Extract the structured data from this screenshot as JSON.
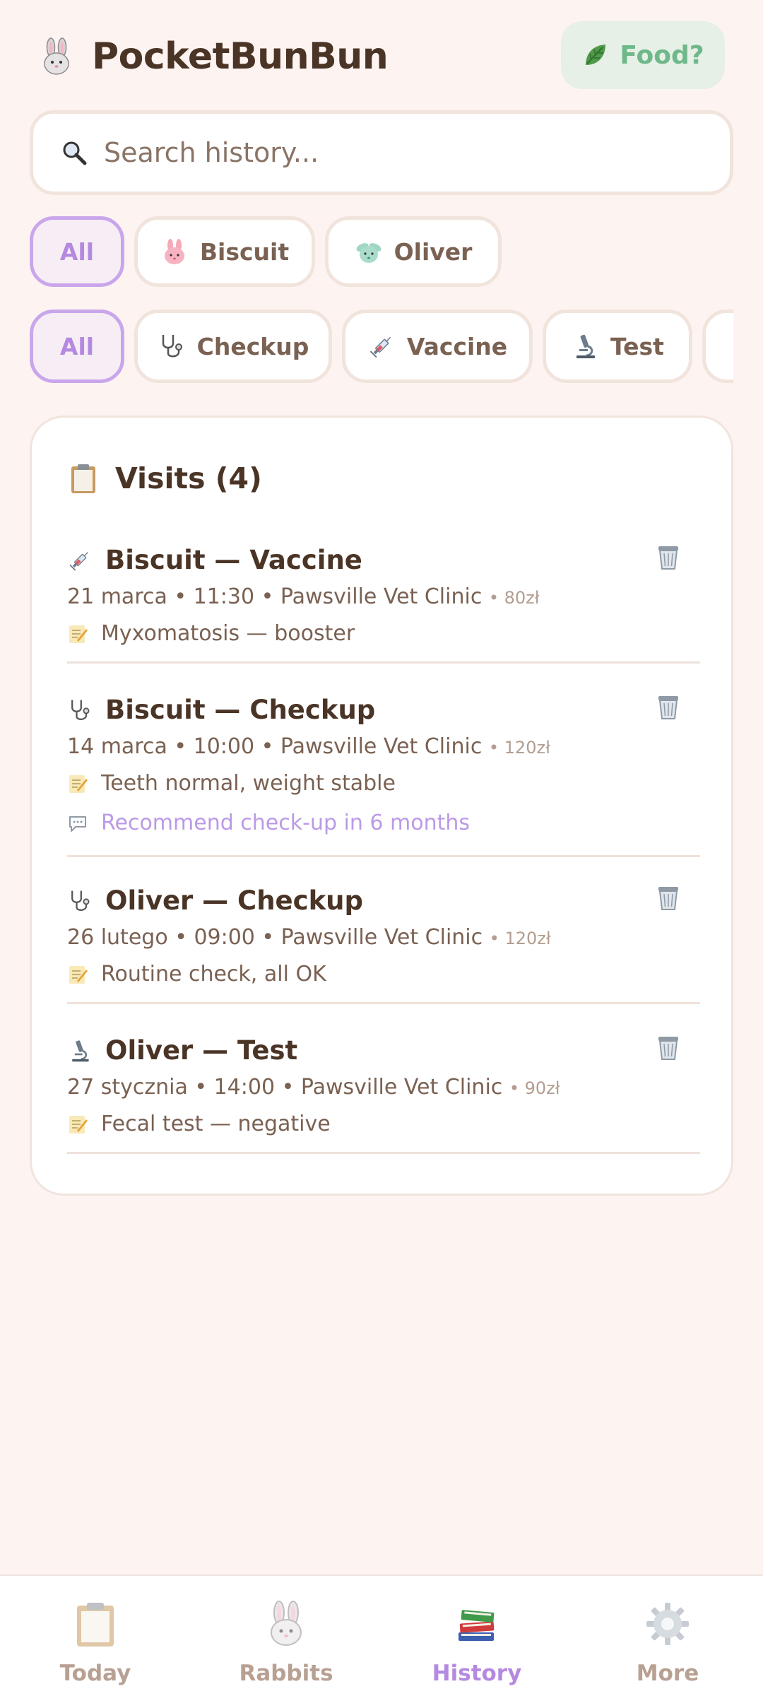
{
  "app": {
    "title": "PocketBunBun",
    "food_button": "Food?"
  },
  "search": {
    "placeholder": "Search history..."
  },
  "rabbit_filters": [
    {
      "label": "All",
      "active": true
    },
    {
      "label": "Biscuit",
      "icon": "pink-bunny-icon",
      "active": false
    },
    {
      "label": "Oliver",
      "icon": "mint-bunny-icon",
      "active": false
    }
  ],
  "type_filters": [
    {
      "label": "All",
      "active": true
    },
    {
      "label": "Checkup",
      "icon": "stethoscope-icon",
      "active": false
    },
    {
      "label": "Vaccine",
      "icon": "syringe-icon",
      "active": false
    },
    {
      "label": "Test",
      "icon": "microscope-icon",
      "active": false
    }
  ],
  "visits_card": {
    "title": "Visits (4)",
    "items": [
      {
        "title": "Biscuit — Vaccine",
        "icon": "syringe-icon",
        "meta": "21 marca • 11:30 • Pawsville Vet Clinic",
        "price": "• 80zł",
        "note": "Myxomatosis — booster"
      },
      {
        "title": "Biscuit — Checkup",
        "icon": "stethoscope-icon",
        "meta": "14 marca • 10:00 • Pawsville Vet Clinic",
        "price": "• 120zł",
        "note": "Teeth normal, weight stable",
        "comment": "Recommend check-up in 6 months"
      },
      {
        "title": "Oliver — Checkup",
        "icon": "stethoscope-icon",
        "meta": "26 lutego • 09:00 • Pawsville Vet Clinic",
        "price": "• 120zł",
        "note": "Routine check, all OK"
      },
      {
        "title": "Oliver — Test",
        "icon": "microscope-icon",
        "meta": "27 stycznia • 14:00 • Pawsville Vet Clinic",
        "price": "• 90zł",
        "note": "Fecal test — negative"
      }
    ]
  },
  "bottom_nav": [
    {
      "label": "Today",
      "icon": "clipboard-icon",
      "active": false
    },
    {
      "label": "Rabbits",
      "icon": "rabbit-icon",
      "active": false
    },
    {
      "label": "History",
      "icon": "books-icon",
      "active": true
    },
    {
      "label": "More",
      "icon": "gear-icon",
      "active": false
    }
  ],
  "colors": {
    "background": "#fdf4f1",
    "accent_purple": "#b589e0",
    "food_green": "#6fb88a",
    "text_brown": "#4a3426"
  }
}
